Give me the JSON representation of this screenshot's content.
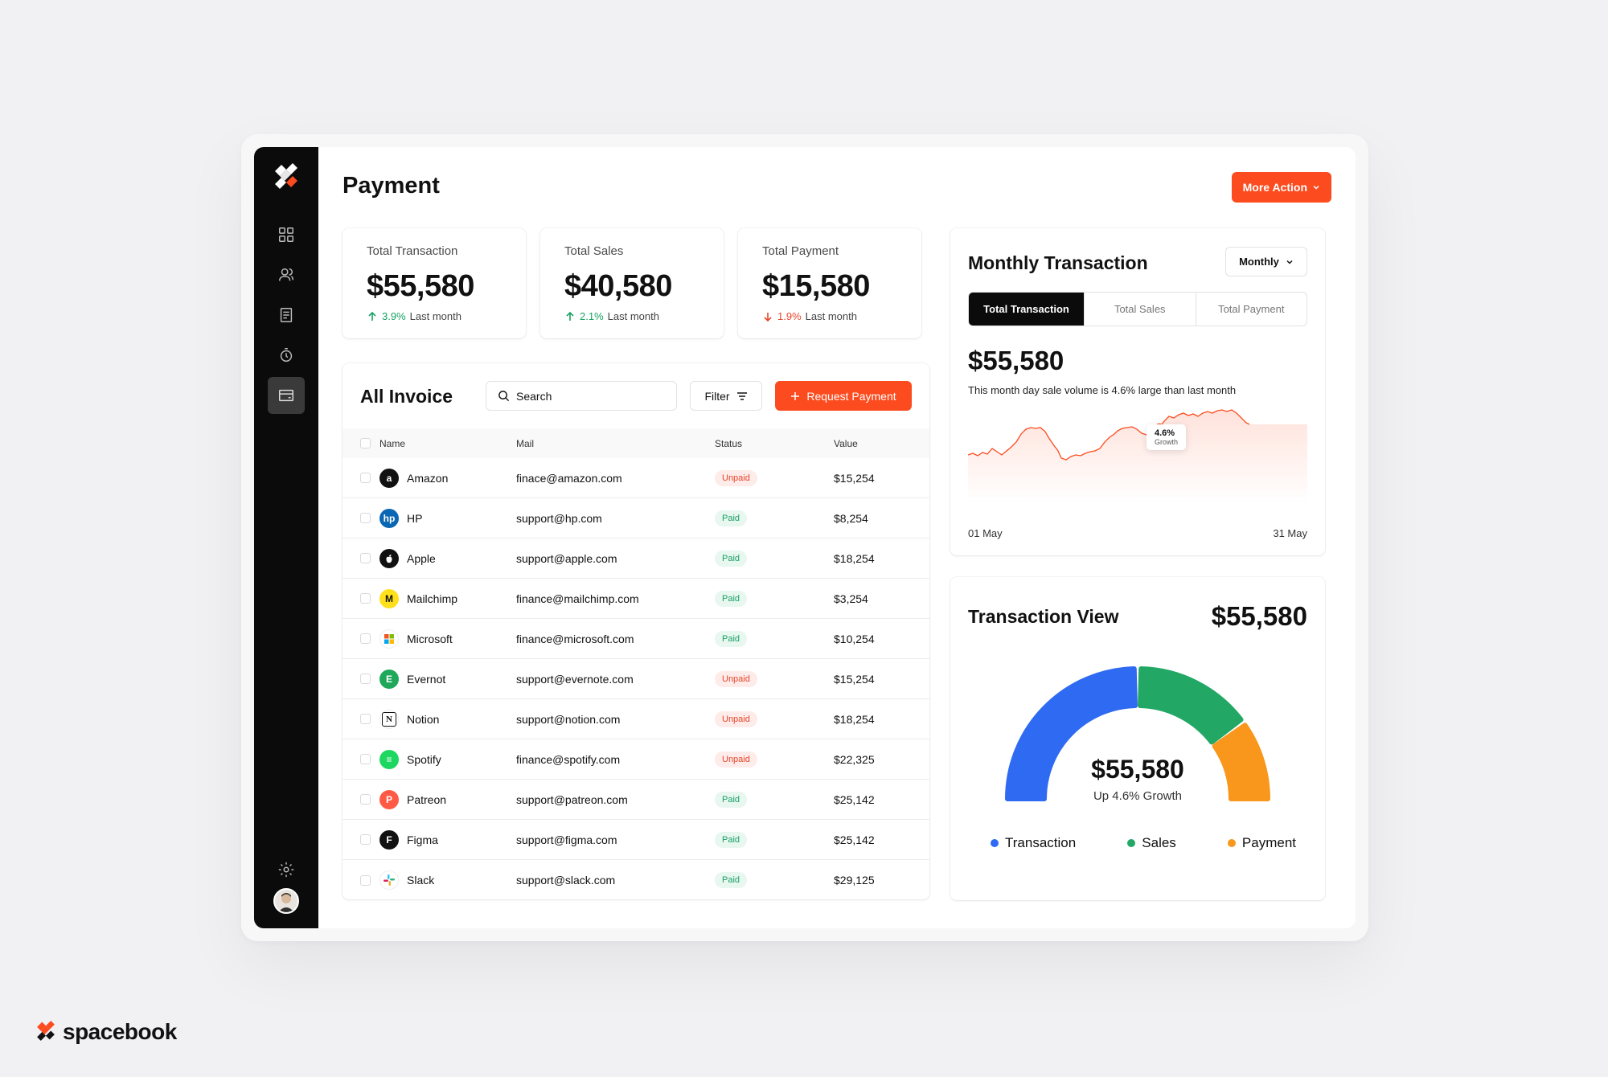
{
  "page": {
    "title": "Payment",
    "more_action": "More Action"
  },
  "stats": [
    {
      "label": "Total Transaction",
      "value": "$55,580",
      "change": "3.9%",
      "direction": "up",
      "period": "Last month"
    },
    {
      "label": "Total Sales",
      "value": "$40,580",
      "change": "2.1%",
      "direction": "up",
      "period": "Last month"
    },
    {
      "label": "Total Payment",
      "value": "$15,580",
      "change": "1.9%",
      "direction": "down",
      "period": "Last month"
    }
  ],
  "invoice": {
    "title": "All Invoice",
    "search_placeholder": "Search",
    "filter_label": "Filter",
    "request_label": "Request Payment",
    "columns": [
      "Name",
      "Mail",
      "Status",
      "Value"
    ],
    "rows": [
      {
        "name": "Amazon",
        "mail": "finace@amazon.com",
        "status": "Unpaid",
        "value": "$15,254",
        "icon": "amazon-icon"
      },
      {
        "name": "HP",
        "mail": "support@hp.com",
        "status": "Paid",
        "value": "$8,254",
        "icon": "hp-icon"
      },
      {
        "name": "Apple",
        "mail": "support@apple.com",
        "status": "Paid",
        "value": "$18,254",
        "icon": "apple-icon"
      },
      {
        "name": "Mailchimp",
        "mail": "finance@mailchimp.com",
        "status": "Paid",
        "value": "$3,254",
        "icon": "mailchimp-icon"
      },
      {
        "name": "Microsoft",
        "mail": "finance@microsoft.com",
        "status": "Paid",
        "value": "$10,254",
        "icon": "microsoft-icon"
      },
      {
        "name": "Evernot",
        "mail": "support@evernote.com",
        "status": "Unpaid",
        "value": "$15,254",
        "icon": "evernote-icon"
      },
      {
        "name": "Notion",
        "mail": "support@notion.com",
        "status": "Unpaid",
        "value": "$18,254",
        "icon": "notion-icon"
      },
      {
        "name": "Spotify",
        "mail": "finance@spotify.com",
        "status": "Unpaid",
        "value": "$22,325",
        "icon": "spotify-icon"
      },
      {
        "name": "Patreon",
        "mail": "support@patreon.com",
        "status": "Paid",
        "value": "$25,142",
        "icon": "patreon-icon"
      },
      {
        "name": "Figma",
        "mail": "support@figma.com",
        "status": "Paid",
        "value": "$25,142",
        "icon": "figma-icon"
      },
      {
        "name": "Slack",
        "mail": "support@slack.com",
        "status": "Paid",
        "value": "$29,125",
        "icon": "slack-icon"
      }
    ]
  },
  "monthly": {
    "title": "Monthly Transaction",
    "period_select": "Monthly",
    "tabs": [
      "Total Transaction",
      "Total Sales",
      "Total Payment"
    ],
    "active_tab": "Total Transaction",
    "value": "$55,580",
    "description": "This month day sale volume is 4.6% large than last month",
    "tooltip_value": "4.6%",
    "tooltip_label": "Growth",
    "x_start": "01 May",
    "x_end": "31 May"
  },
  "transaction_view": {
    "title": "Transaction View",
    "total": "$55,580",
    "center_value": "$55,580",
    "center_label": "Up 4.6% Growth",
    "segments": [
      {
        "name": "Transaction",
        "color": "#2f6bf2",
        "share": 0.5
      },
      {
        "name": "Sales",
        "color": "#22a765",
        "share": 0.3
      },
      {
        "name": "Payment",
        "color": "#f8971c",
        "share": 0.2
      }
    ]
  },
  "colors": {
    "accent": "#fc4b1e",
    "sidebar": "#0b0b0b",
    "paid": "#18a163",
    "unpaid": "#e8452b"
  },
  "brand": {
    "name": "spacebook"
  }
}
